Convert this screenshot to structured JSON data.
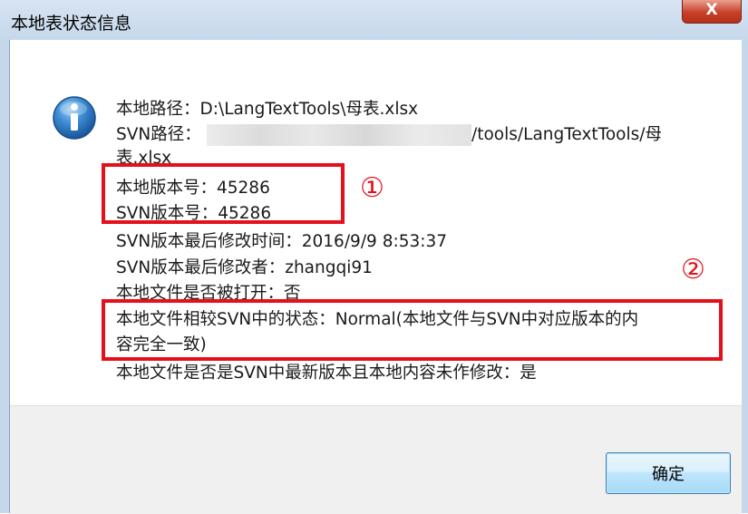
{
  "window": {
    "title": "本地表状态信息",
    "close_label": "X"
  },
  "icon": "info-icon",
  "message": {
    "lines": [
      "本地路径：D:\\LangTextTools\\母表.xlsx",
      "SVN路径：",
      "/tools/LangTextTools/母",
      "表.xlsx",
      "本地版本号：45286",
      "SVN版本号：45286",
      "SVN版本最后修改时间：2016/9/9 8:53:37",
      "SVN版本最后修改者：zhangqi91",
      "本地文件是否被打开：否",
      "本地文件相较SVN中的状态：Normal(本地文件与SVN中对应版本的内",
      "容完全一致)",
      "本地文件是否是SVN中最新版本且本地内容未作修改：是"
    ]
  },
  "annotations": [
    {
      "label": "①"
    },
    {
      "label": "②"
    }
  ],
  "footer": {
    "ok_label": "确定"
  },
  "colors": {
    "annotation_red": "#e5101a",
    "titlebar": "#c6d8ec",
    "close_button": "#c7402a",
    "footer_bg": "#f0f0f0"
  }
}
